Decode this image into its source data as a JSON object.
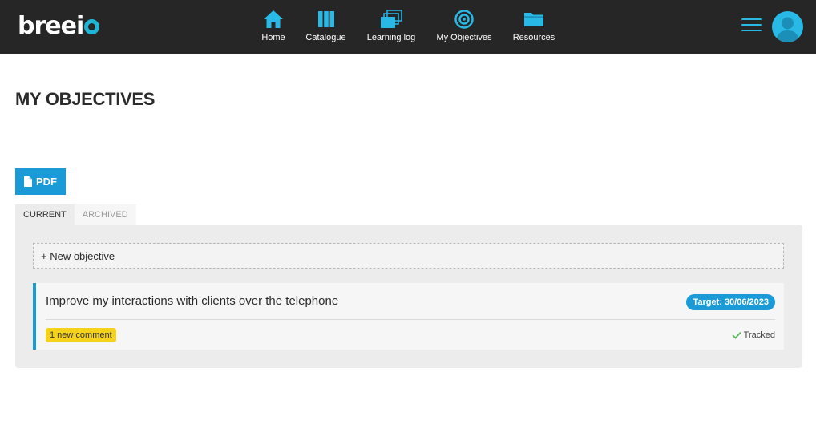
{
  "header": {
    "logo": {
      "prefix": "breei",
      "suffix_ring": "o"
    },
    "nav": [
      {
        "label": "Home",
        "icon": "home-icon"
      },
      {
        "label": "Catalogue",
        "icon": "catalogue-icon"
      },
      {
        "label": "Learning log",
        "icon": "learning-log-icon"
      },
      {
        "label": "My Objectives",
        "icon": "target-icon"
      },
      {
        "label": "Resources",
        "icon": "folder-icon"
      }
    ],
    "menu_icon": "hamburger-menu-icon",
    "avatar_icon": "user-avatar-icon"
  },
  "page": {
    "title": "MY OBJECTIVES",
    "pdf_button": {
      "label": "PDF",
      "icon": "document-icon"
    },
    "tabs": [
      {
        "label": "CURRENT",
        "active": true
      },
      {
        "label": "ARCHIVED",
        "active": false
      }
    ],
    "new_objective": "+ New objective",
    "objectives": [
      {
        "title": "Improve my interactions with clients over the telephone",
        "target": "Target: 30/06/2023",
        "comments": "1 new comment",
        "status": "Tracked",
        "status_icon": "checkmark-icon"
      }
    ]
  },
  "colors": {
    "topbar": "#262626",
    "accent": "#1a9ad6",
    "icon_blue": "#29b9e6",
    "comment_badge": "#f5d31c",
    "tracked_check": "#5cb85c"
  }
}
